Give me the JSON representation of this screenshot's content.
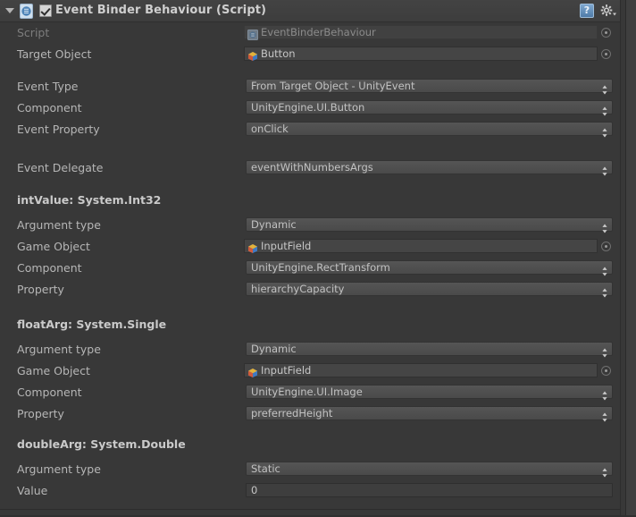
{
  "header": {
    "title": "Event Binder Behaviour (Script)",
    "enabled_checkbox": "checked",
    "foldout_state": "expanded",
    "help_label": "?",
    "icons": {
      "foldout": "triangle-down-icon",
      "script": "csharp-script-icon",
      "help": "help-icon",
      "gear": "gear-icon"
    }
  },
  "fields": {
    "script": {
      "label": "Script",
      "value": "EventBinderBehaviour",
      "icon": "csharp-script-icon",
      "disabled": true
    },
    "target_object": {
      "label": "Target Object",
      "value": "Button",
      "icon": "gameobject-cube-icon",
      "disabled": false
    },
    "event_type": {
      "label": "Event Type",
      "value": "From Target Object - UnityEvent"
    },
    "component": {
      "label": "Component",
      "value": "UnityEngine.UI.Button"
    },
    "event_property": {
      "label": "Event Property",
      "value": "onClick"
    },
    "event_delegate": {
      "label": "Event Delegate",
      "value": "eventWithNumbersArgs"
    }
  },
  "sections": [
    {
      "title": "intValue: System.Int32",
      "rows": [
        {
          "label": "Argument type",
          "value": "Dynamic",
          "kind": "dropdown"
        },
        {
          "label": "Game Object",
          "value": "InputField",
          "kind": "object",
          "icon": "gameobject-cube-icon"
        },
        {
          "label": "Component",
          "value": "UnityEngine.RectTransform",
          "kind": "dropdown"
        },
        {
          "label": "Property",
          "value": "hierarchyCapacity",
          "kind": "dropdown"
        }
      ]
    },
    {
      "title": "floatArg: System.Single",
      "rows": [
        {
          "label": "Argument type",
          "value": "Dynamic",
          "kind": "dropdown"
        },
        {
          "label": "Game Object",
          "value": "InputField",
          "kind": "object",
          "icon": "gameobject-cube-icon"
        },
        {
          "label": "Component",
          "value": "UnityEngine.UI.Image",
          "kind": "dropdown"
        },
        {
          "label": "Property",
          "value": "preferredHeight",
          "kind": "dropdown"
        }
      ]
    },
    {
      "title": "doubleArg: System.Double",
      "rows": [
        {
          "label": "Argument type",
          "value": "Static",
          "kind": "dropdown"
        },
        {
          "label": "Value",
          "value": "0",
          "kind": "text"
        }
      ]
    }
  ],
  "colors": {
    "panel_bg": "#383838",
    "header_bg": "#424242",
    "label_text": "#b6b6b6",
    "value_text": "#c2c2c2",
    "disabled_text": "#7d7d7d",
    "dropdown_bg": "#4f4f4f",
    "object_field_bg": "#454545",
    "help_blue": "#5f8fbf"
  }
}
